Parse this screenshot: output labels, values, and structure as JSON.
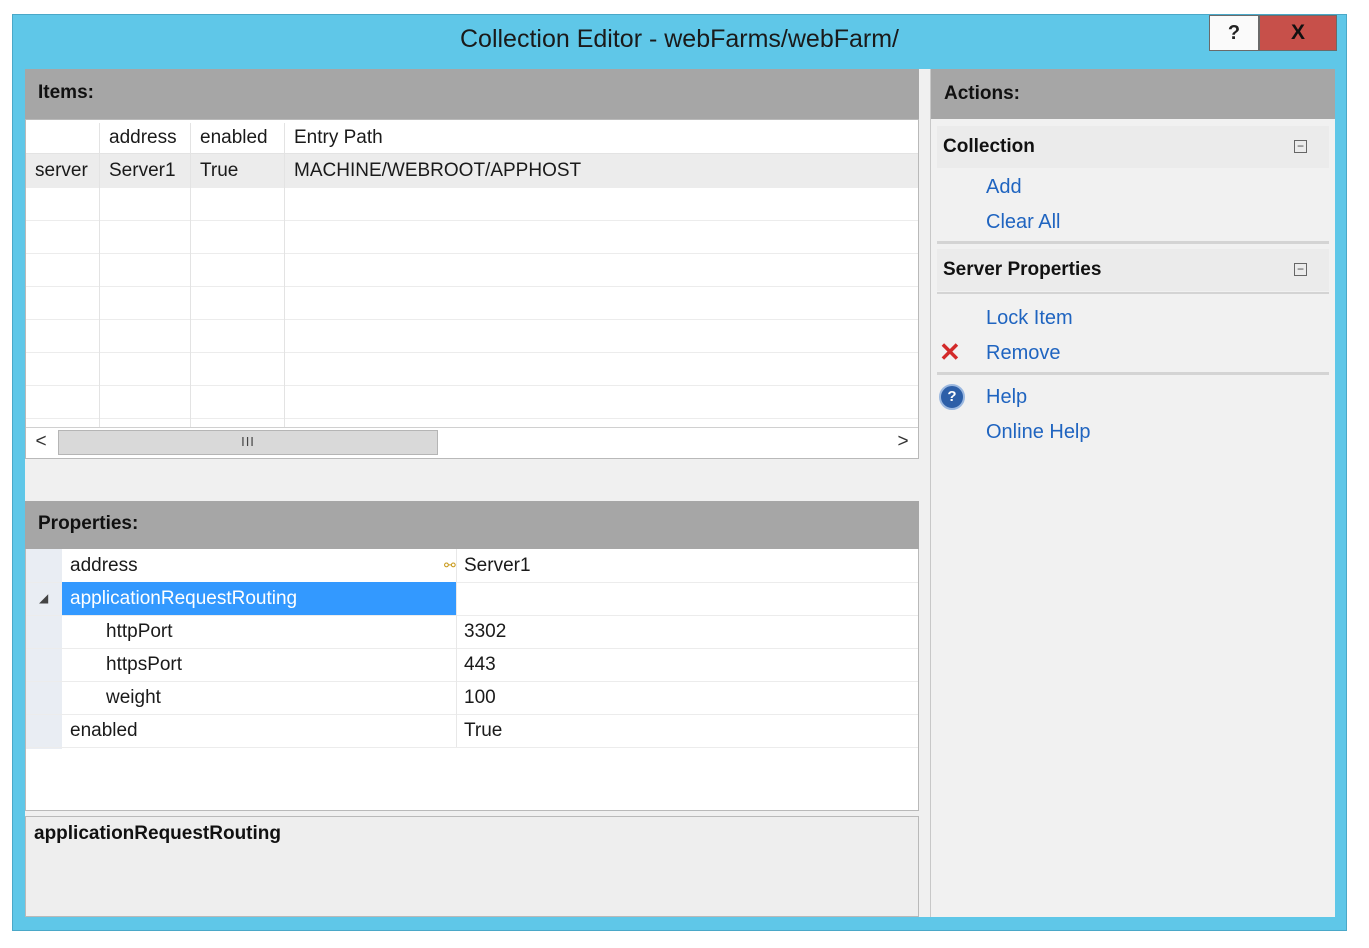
{
  "window": {
    "title": "Collection Editor - webFarms/webFarm/",
    "help_btn": "?",
    "close_btn": "X"
  },
  "items": {
    "header": "Items:",
    "columns": [
      "",
      "address",
      "enabled",
      "Entry Path"
    ],
    "rows": [
      [
        "server",
        "Server1",
        "True",
        "MACHINE/WEBROOT/APPHOST"
      ]
    ],
    "scroll_left": "<",
    "scroll_right": ">",
    "scroll_thumb": "III"
  },
  "properties": {
    "header": "Properties:",
    "rows": [
      {
        "name": "address",
        "value": "Server1"
      },
      {
        "name": "applicationRequestRouting",
        "value": "",
        "expander": "◢"
      },
      {
        "name": "httpPort",
        "value": "3302"
      },
      {
        "name": "httpsPort",
        "value": "443"
      },
      {
        "name": "weight",
        "value": "100"
      },
      {
        "name": "enabled",
        "value": "True"
      }
    ],
    "description_title": "applicationRequestRouting"
  },
  "actions": {
    "header": "Actions:",
    "collection": {
      "title": "Collection",
      "items": [
        "Add",
        "Clear All"
      ]
    },
    "server_properties": {
      "title": "Server Properties",
      "items": [
        "Lock Item",
        "Remove"
      ]
    },
    "help_items": [
      "Help",
      "Online Help"
    ],
    "collapse_glyph": "−",
    "remove_glyph": "✕",
    "help_glyph": "?"
  }
}
